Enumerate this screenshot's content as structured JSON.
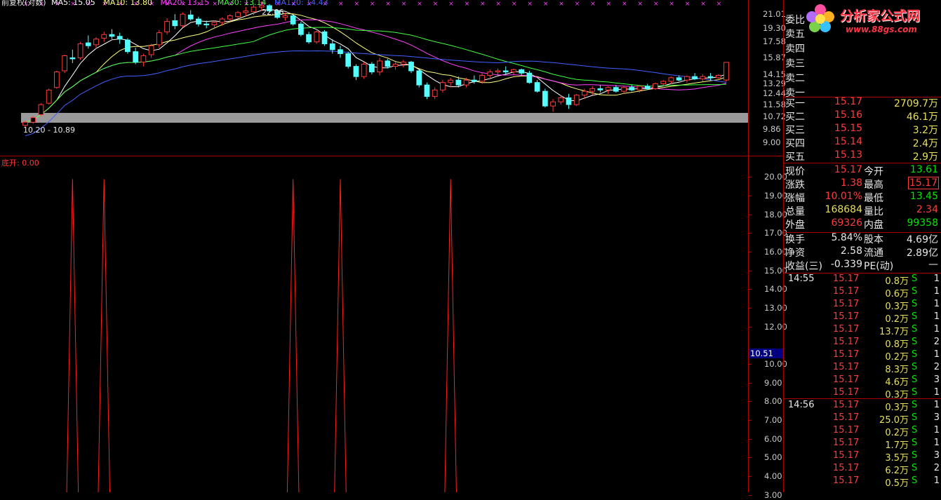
{
  "app": {
    "main_legend": {
      "name": "前复权(对数)",
      "ma5": "MA5: 15.05",
      "ma10": "MA10: 13.80",
      "ma20": "MA20: 13.15",
      "ma30": "MA30: 13.14",
      "ma120": "MA120: 14.43"
    },
    "sub_legend": {
      "name": "底开",
      "value": "0.00"
    },
    "annot_high": "22.06",
    "annot_low": "10.20 - 10.89"
  },
  "main_axis_ticks": [
    "21.01",
    "19.30",
    "17.58",
    "15.87",
    "14.15",
    "13.29",
    "12.44",
    "11.58",
    "10.72",
    "9.86",
    "9.00"
  ],
  "sub_axis_ticks": [
    "20.00",
    "19.00",
    "18.00",
    "17.00",
    "16.00",
    "15.00",
    "14.00",
    "13.00",
    "12.00",
    "10.00",
    "9.00",
    "8.00",
    "7.00",
    "6.00",
    "5.00",
    "4.00",
    "3.00"
  ],
  "sub_axis_current": "10.51",
  "logo": {
    "title": "分析家公式网",
    "url": "www.88gs.com"
  },
  "order_book": {
    "committee_label": "委比",
    "sells": [
      {
        "label": "卖五",
        "price": "",
        "vol": ""
      },
      {
        "label": "卖四",
        "price": "",
        "vol": ""
      },
      {
        "label": "卖三",
        "price": "",
        "vol": ""
      },
      {
        "label": "卖二",
        "price": "",
        "vol": ""
      },
      {
        "label": "卖一",
        "price": "",
        "vol": ""
      }
    ],
    "buys": [
      {
        "label": "买一",
        "price": "15.17",
        "vol": "2709.7万"
      },
      {
        "label": "买二",
        "price": "15.16",
        "vol": "46.1万"
      },
      {
        "label": "买三",
        "price": "15.15",
        "vol": "3.2万"
      },
      {
        "label": "买四",
        "price": "15.14",
        "vol": "2.4万"
      },
      {
        "label": "买五",
        "price": "15.13",
        "vol": "2.9万"
      }
    ]
  },
  "quote": [
    {
      "l1": "现价",
      "v1": "15.17",
      "c1": "red",
      "l2": "今开",
      "v2": "13.61",
      "c2": "green"
    },
    {
      "l1": "涨跌",
      "v1": "1.38",
      "c1": "red",
      "l2": "最高",
      "v2": "15.17",
      "c2": "red"
    },
    {
      "l1": "涨幅",
      "v1": "10.01%",
      "c1": "red",
      "l2": "最低",
      "v2": "13.45",
      "c2": "green"
    },
    {
      "l1": "总量",
      "v1": "168684",
      "c1": "yellow",
      "l2": "量比",
      "v2": "2.34",
      "c2": "red"
    },
    {
      "l1": "外盘",
      "v1": "69326",
      "c1": "red",
      "l2": "内盘",
      "v2": "99358",
      "c2": "green"
    }
  ],
  "fundamentals": [
    {
      "l1": "换手",
      "v1": "5.84%",
      "l2": "股本",
      "v2": "4.69亿"
    },
    {
      "l1": "净资",
      "v1": "2.58",
      "l2": "流通",
      "v2": "2.89亿"
    },
    {
      "l1": "收益(三)",
      "v1": "-0.339",
      "l2": "PE(动)",
      "v2": "—"
    }
  ],
  "trades": [
    {
      "time": "14:55",
      "price": "15.17",
      "vol": "0.8万",
      "side": "S",
      "n": "1"
    },
    {
      "time": "",
      "price": "15.17",
      "vol": "0.6万",
      "side": "S",
      "n": "1"
    },
    {
      "time": "",
      "price": "15.17",
      "vol": "0.3万",
      "side": "S",
      "n": "1"
    },
    {
      "time": "",
      "price": "15.17",
      "vol": "0.2万",
      "side": "S",
      "n": "1"
    },
    {
      "time": "",
      "price": "15.17",
      "vol": "13.7万",
      "side": "S",
      "n": "1"
    },
    {
      "time": "",
      "price": "15.17",
      "vol": "0.8万",
      "side": "S",
      "n": "2"
    },
    {
      "time": "",
      "price": "15.17",
      "vol": "0.2万",
      "side": "S",
      "n": "1"
    },
    {
      "time": "",
      "price": "15.17",
      "vol": "8.3万",
      "side": "S",
      "n": "2"
    },
    {
      "time": "",
      "price": "15.17",
      "vol": "4.6万",
      "side": "S",
      "n": "3"
    },
    {
      "time": "",
      "price": "15.17",
      "vol": "0.3万",
      "side": "S",
      "n": "1"
    },
    {
      "time": "14:56",
      "price": "15.17",
      "vol": "0.3万",
      "side": "S",
      "n": "1"
    },
    {
      "time": "",
      "price": "15.17",
      "vol": "25.0万",
      "side": "S",
      "n": "3"
    },
    {
      "time": "",
      "price": "15.17",
      "vol": "0.2万",
      "side": "S",
      "n": "1"
    },
    {
      "time": "",
      "price": "15.17",
      "vol": "1.7万",
      "side": "S",
      "n": "1"
    },
    {
      "time": "",
      "price": "15.17",
      "vol": "3.5万",
      "side": "S",
      "n": "3"
    },
    {
      "time": "",
      "price": "15.17",
      "vol": "6.2万",
      "side": "S",
      "n": "2"
    },
    {
      "time": "",
      "price": "15.17",
      "vol": "0.5万",
      "side": "S",
      "n": "1"
    }
  ],
  "colors": {
    "up": "#ff3b3b",
    "down": "#54ffff",
    "ma5": "#ffffff",
    "ma10": "#ffff80",
    "ma20": "#ff40ff",
    "ma30": "#40ff40",
    "ma120": "#4060ff",
    "frame": "#aa0000"
  },
  "chart_data": [
    {
      "type": "candlestick",
      "title": "前复权(对数)",
      "scale": "log",
      "ylim": [
        9.0,
        21.5
      ],
      "candles": [
        [
          10.3,
          10.6,
          10.2,
          10.5
        ],
        [
          10.5,
          10.9,
          10.4,
          10.8
        ],
        [
          11.0,
          11.8,
          10.9,
          11.7
        ],
        [
          11.8,
          12.9,
          11.7,
          12.8
        ],
        [
          13.0,
          14.4,
          12.9,
          14.3
        ],
        [
          14.4,
          15.9,
          14.2,
          15.8
        ],
        [
          15.6,
          16.4,
          15.1,
          15.5
        ],
        [
          15.6,
          17.2,
          15.4,
          17.0
        ],
        [
          17.1,
          17.9,
          16.5,
          16.8
        ],
        [
          16.9,
          17.7,
          16.5,
          17.5
        ],
        [
          17.6,
          18.3,
          17.2,
          18.0
        ],
        [
          18.0,
          18.6,
          17.5,
          17.8
        ],
        [
          17.8,
          18.2,
          17.0,
          17.5
        ],
        [
          17.4,
          17.6,
          16.0,
          16.2
        ],
        [
          16.2,
          16.6,
          15.0,
          15.2
        ],
        [
          15.2,
          16.0,
          14.8,
          15.8
        ],
        [
          15.9,
          17.0,
          15.6,
          16.8
        ],
        [
          16.9,
          18.5,
          16.6,
          18.2
        ],
        [
          18.3,
          19.9,
          18.0,
          19.5
        ],
        [
          19.6,
          20.4,
          18.6,
          19.0
        ],
        [
          19.0,
          20.6,
          18.8,
          20.4
        ],
        [
          20.3,
          20.9,
          19.6,
          19.8
        ],
        [
          19.8,
          20.1,
          18.9,
          19.2
        ],
        [
          19.2,
          19.6,
          18.7,
          19.1
        ],
        [
          19.1,
          19.6,
          18.6,
          19.4
        ],
        [
          19.4,
          20.0,
          19.0,
          19.8
        ],
        [
          19.8,
          20.4,
          19.5,
          20.2
        ],
        [
          20.1,
          20.8,
          19.8,
          20.6
        ],
        [
          20.6,
          21.3,
          20.1,
          20.8
        ],
        [
          20.7,
          21.7,
          20.3,
          21.3
        ],
        [
          21.3,
          22.06,
          20.8,
          21.5
        ],
        [
          21.5,
          21.7,
          20.6,
          20.8
        ],
        [
          20.8,
          21.0,
          19.8,
          20.0
        ],
        [
          20.0,
          20.6,
          19.6,
          20.2
        ],
        [
          20.2,
          20.4,
          19.0,
          19.2
        ],
        [
          19.2,
          19.5,
          17.8,
          18.0
        ],
        [
          18.0,
          18.3,
          17.0,
          17.2
        ],
        [
          17.2,
          18.6,
          17.0,
          18.3
        ],
        [
          18.3,
          18.5,
          16.8,
          17.0
        ],
        [
          17.0,
          17.5,
          16.0,
          16.4
        ],
        [
          16.4,
          16.8,
          15.6,
          16.0
        ],
        [
          16.0,
          16.2,
          14.6,
          14.8
        ],
        [
          14.8,
          15.0,
          13.6,
          13.9
        ],
        [
          13.9,
          15.2,
          13.7,
          15.0
        ],
        [
          15.0,
          15.2,
          14.1,
          14.3
        ],
        [
          14.3,
          15.6,
          14.0,
          15.3
        ],
        [
          15.3,
          15.5,
          14.6,
          14.8
        ],
        [
          14.8,
          15.2,
          14.5,
          15.0
        ],
        [
          15.0,
          15.4,
          14.7,
          15.2
        ],
        [
          15.2,
          15.3,
          14.2,
          14.4
        ],
        [
          14.4,
          14.6,
          13.0,
          13.2
        ],
        [
          13.2,
          13.4,
          12.1,
          12.3
        ],
        [
          12.3,
          13.0,
          12.1,
          12.8
        ],
        [
          12.8,
          13.6,
          12.6,
          13.4
        ],
        [
          13.4,
          13.8,
          13.0,
          13.6
        ],
        [
          13.6,
          13.9,
          13.0,
          13.2
        ],
        [
          13.2,
          13.8,
          13.0,
          13.6
        ],
        [
          13.6,
          14.0,
          13.3,
          13.5
        ],
        [
          13.5,
          14.2,
          13.3,
          14.0
        ],
        [
          14.0,
          14.5,
          13.8,
          14.3
        ],
        [
          14.3,
          14.6,
          14.0,
          14.4
        ],
        [
          14.4,
          14.8,
          14.1,
          14.3
        ],
        [
          14.3,
          14.6,
          14.0,
          14.5
        ],
        [
          14.5,
          14.6,
          14.0,
          14.2
        ],
        [
          14.2,
          14.4,
          13.3,
          13.4
        ],
        [
          13.4,
          13.6,
          12.6,
          12.7
        ],
        [
          12.7,
          12.9,
          11.5,
          11.6
        ],
        [
          11.6,
          12.1,
          11.2,
          11.9
        ],
        [
          11.9,
          12.4,
          11.7,
          12.2
        ],
        [
          12.2,
          12.5,
          11.4,
          11.7
        ],
        [
          11.7,
          12.5,
          11.6,
          12.4
        ],
        [
          12.4,
          12.9,
          12.1,
          12.7
        ],
        [
          12.7,
          13.1,
          12.4,
          12.9
        ],
        [
          12.9,
          13.2,
          12.6,
          12.8
        ],
        [
          12.8,
          13.1,
          12.5,
          13.0
        ],
        [
          13.0,
          13.2,
          12.6,
          12.7
        ],
        [
          12.7,
          13.1,
          12.5,
          13.0
        ],
        [
          13.0,
          13.2,
          12.7,
          12.8
        ],
        [
          12.8,
          13.2,
          12.6,
          13.1
        ],
        [
          13.1,
          13.3,
          12.8,
          12.9
        ],
        [
          12.9,
          13.4,
          12.8,
          13.3
        ],
        [
          13.3,
          13.6,
          13.1,
          13.5
        ],
        [
          13.5,
          13.9,
          13.3,
          13.8
        ],
        [
          13.8,
          14.0,
          13.5,
          13.6
        ],
        [
          13.6,
          14.0,
          13.4,
          13.9
        ],
        [
          13.9,
          14.2,
          13.6,
          13.7
        ],
        [
          13.7,
          14.1,
          13.5,
          13.9
        ],
        [
          13.9,
          14.2,
          13.6,
          13.8
        ],
        [
          13.8,
          14.1,
          13.6,
          14.0
        ],
        [
          13.61,
          15.17,
          13.45,
          15.17
        ]
      ]
    },
    {
      "type": "line",
      "title": "底开",
      "ylim": [
        2.5,
        20.5
      ],
      "spikes_at_bar": [
        6,
        10,
        34,
        40,
        54
      ],
      "spike_value": 20.0,
      "baseline": 0.0
    }
  ]
}
